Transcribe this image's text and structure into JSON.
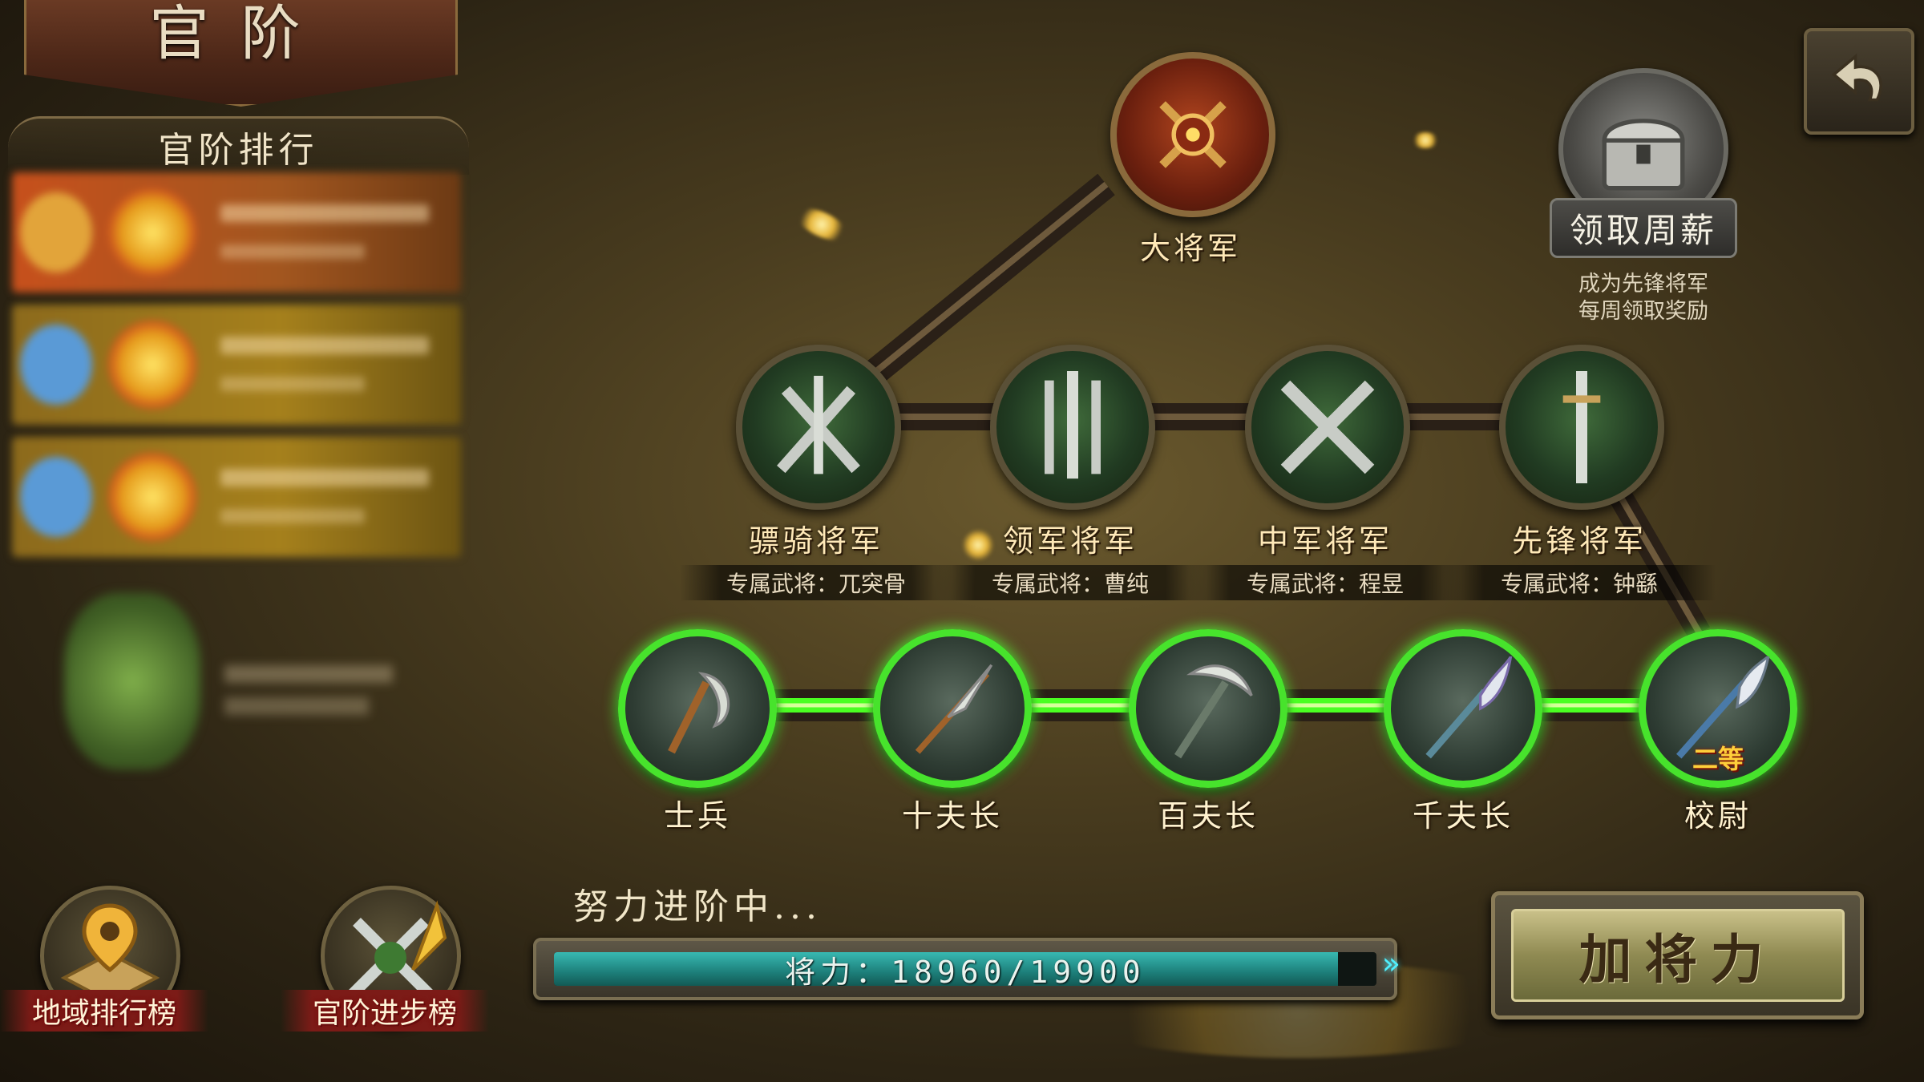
{
  "page": {
    "title": "官阶",
    "ranking_header": "官阶排行"
  },
  "side_buttons": {
    "region_rank": "地域排行榜",
    "rank_progress": "官阶进步榜"
  },
  "top_rank": {
    "name": "大将军"
  },
  "generals": [
    {
      "name": "骠骑将军",
      "exclusive": "专属武将：兀突骨"
    },
    {
      "name": "领军将军",
      "exclusive": "专属武将：曹纯"
    },
    {
      "name": "中军将军",
      "exclusive": "专属武将：程昱"
    },
    {
      "name": "先锋将军",
      "exclusive": "专属武将：钟繇"
    }
  ],
  "basic_ranks": [
    {
      "name": "士兵"
    },
    {
      "name": "十夫长"
    },
    {
      "name": "百夫长"
    },
    {
      "name": "千夫长"
    },
    {
      "name": "校尉",
      "badge": "二等"
    }
  ],
  "weekly_chest": {
    "button": "领取周薪",
    "hint_line1": "成为先锋将军",
    "hint_line2": "每周领取奖励"
  },
  "progress": {
    "label": "努力进阶中...",
    "text": "将力：18960/19900",
    "current": 18960,
    "max": 19900
  },
  "add_power_button": "加将力",
  "colors": {
    "active_green": "#47e32c",
    "progress_teal": "#2aa39c",
    "gold_text": "#ffe9b8"
  }
}
